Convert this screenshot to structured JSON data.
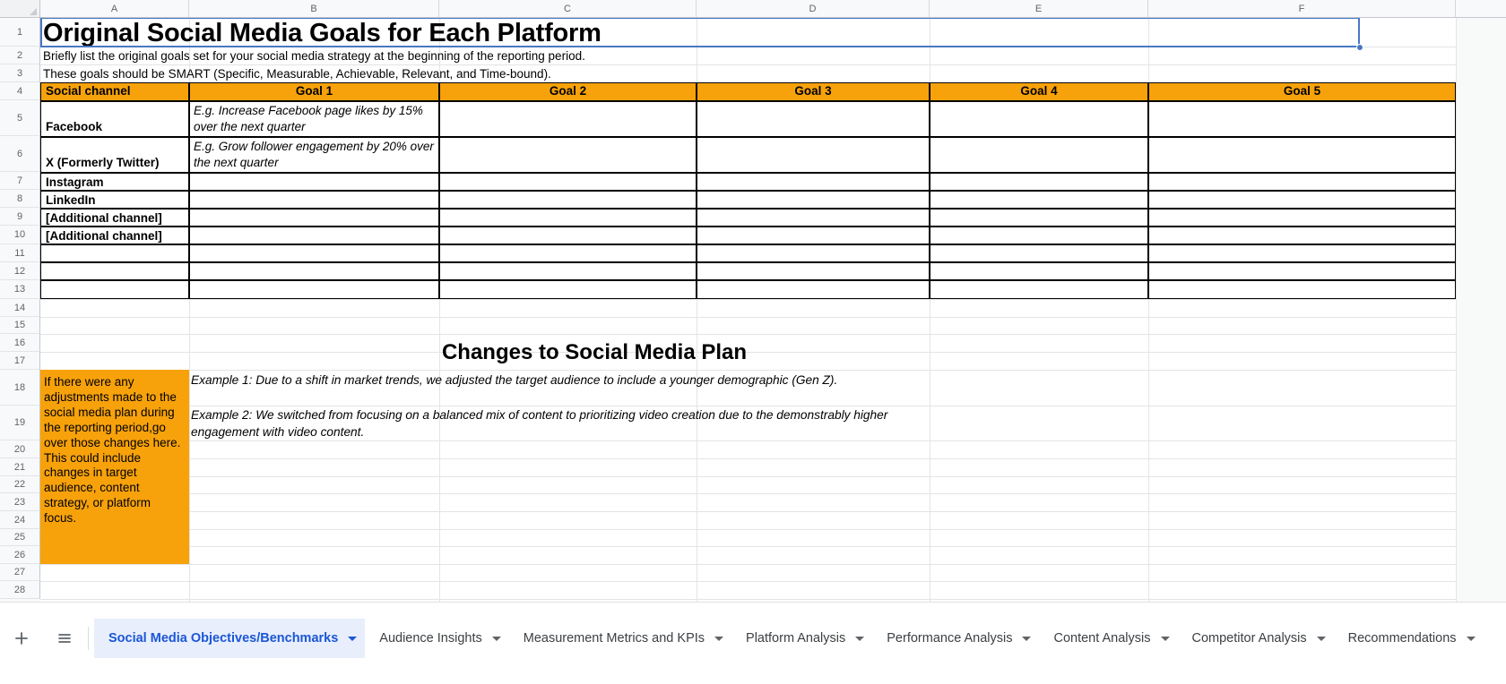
{
  "spreadsheet": {
    "column_headers": [
      "A",
      "B",
      "C",
      "D",
      "E",
      "F"
    ],
    "row_headers": [
      "1",
      "2",
      "3",
      "4",
      "5",
      "6",
      "7",
      "8",
      "9",
      "10",
      "11",
      "12",
      "13",
      "14",
      "15",
      "16",
      "17",
      "18",
      "19",
      "20",
      "21",
      "22",
      "23",
      "24",
      "25",
      "26",
      "27",
      "28"
    ],
    "accent_orange": "#f7a20b",
    "selection_color": "#4a77c4",
    "active_tab_color": "#1a56d6"
  },
  "section1": {
    "title": "Original Social Media Goals for Each Platform",
    "description_line1": "Briefly list the original goals set for your social media strategy at the beginning of the reporting period.",
    "description_line2": "These goals should be SMART (Specific, Measurable, Achievable, Relevant, and Time-bound).",
    "table": {
      "headers": [
        "Social channel",
        "Goal 1",
        "Goal 2",
        "Goal 3",
        "Goal 4",
        "Goal 5"
      ],
      "rows": [
        {
          "channel": "Facebook",
          "goal1": "E.g. Increase Facebook page likes by 15% over the next quarter",
          "goal2": "",
          "goal3": "",
          "goal4": "",
          "goal5": ""
        },
        {
          "channel": "X (Formerly Twitter)",
          "goal1": "E.g. Grow follower engagement by 20% over the next quarter",
          "goal2": "",
          "goal3": "",
          "goal4": "",
          "goal5": ""
        },
        {
          "channel": "Instagram",
          "goal1": "",
          "goal2": "",
          "goal3": "",
          "goal4": "",
          "goal5": ""
        },
        {
          "channel": "LinkedIn",
          "goal1": "",
          "goal2": "",
          "goal3": "",
          "goal4": "",
          "goal5": ""
        },
        {
          "channel": "[Additional channel]",
          "goal1": "",
          "goal2": "",
          "goal3": "",
          "goal4": "",
          "goal5": ""
        },
        {
          "channel": "[Additional channel]",
          "goal1": "",
          "goal2": "",
          "goal3": "",
          "goal4": "",
          "goal5": ""
        },
        {
          "channel": "",
          "goal1": "",
          "goal2": "",
          "goal3": "",
          "goal4": "",
          "goal5": ""
        },
        {
          "channel": "",
          "goal1": "",
          "goal2": "",
          "goal3": "",
          "goal4": "",
          "goal5": ""
        },
        {
          "channel": "",
          "goal1": "",
          "goal2": "",
          "goal3": "",
          "goal4": "",
          "goal5": ""
        }
      ]
    }
  },
  "section2": {
    "title": "Changes to Social Media Plan",
    "sidenote": "If there were any adjustments made to the social media plan during the reporting period,go over those changes here.\nThis could include changes in target audience, content strategy, or platform focus.",
    "example1": "Example 1: Due to a shift in market trends, we adjusted the target audience to include a younger demographic (Gen Z).",
    "example2": "Example 2: We switched from focusing on a balanced mix of content to prioritizing video creation due to the demonstrably higher engagement with video content."
  },
  "sheet_bar": {
    "add_sheet_label": "+",
    "all_sheets_label": "All Sheets",
    "tabs": [
      {
        "label": "Social Media Objectives/Benchmarks",
        "active": true
      },
      {
        "label": "Audience Insights",
        "active": false
      },
      {
        "label": "Measurement Metrics and KPIs",
        "active": false
      },
      {
        "label": "Platform Analysis",
        "active": false
      },
      {
        "label": "Performance Analysis",
        "active": false
      },
      {
        "label": "Content Analysis",
        "active": false
      },
      {
        "label": "Competitor Analysis",
        "active": false
      },
      {
        "label": "Recommendations",
        "active": false
      }
    ]
  }
}
